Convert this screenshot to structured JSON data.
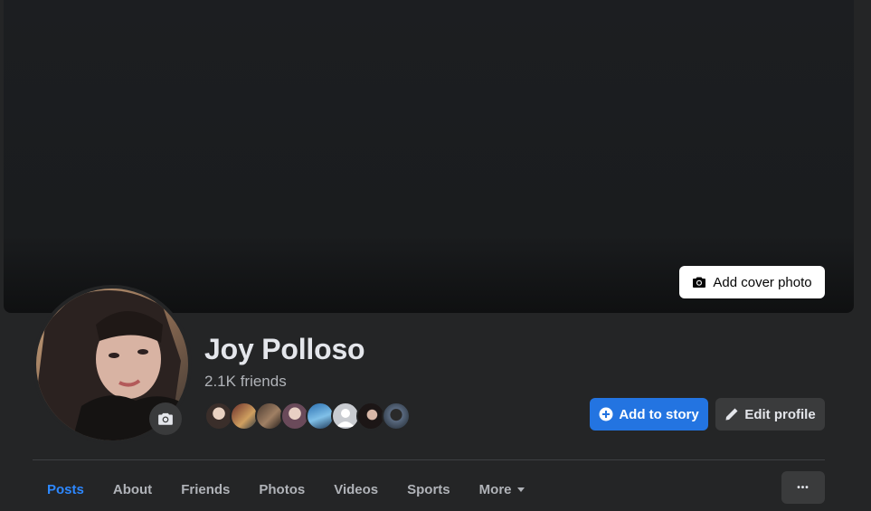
{
  "cover": {
    "add_cover_label": "Add cover photo"
  },
  "profile": {
    "name": "Joy Polloso",
    "friends_count": "2.1K friends",
    "friend_avatars": [
      "friend-1",
      "friend-2",
      "friend-3",
      "friend-4",
      "friend-5",
      "friend-6",
      "friend-7",
      "friend-8"
    ]
  },
  "actions": {
    "add_story_label": "Add to story",
    "edit_profile_label": "Edit profile"
  },
  "tabs": [
    {
      "label": "Posts",
      "active": true
    },
    {
      "label": "About"
    },
    {
      "label": "Friends"
    },
    {
      "label": "Photos"
    },
    {
      "label": "Videos"
    },
    {
      "label": "Sports"
    },
    {
      "label": "More"
    }
  ],
  "more_options_label": "•••",
  "colors": {
    "accent": "#2374e1",
    "active_tab": "#2d88ff",
    "background": "#242526",
    "button_secondary": "#3a3b3c"
  },
  "icons": {
    "add_cover": "camera-icon",
    "avatar_edit": "camera-icon",
    "add_story": "plus-circle-icon",
    "edit_profile": "pencil-icon",
    "more_tab": "caret-down-icon"
  }
}
